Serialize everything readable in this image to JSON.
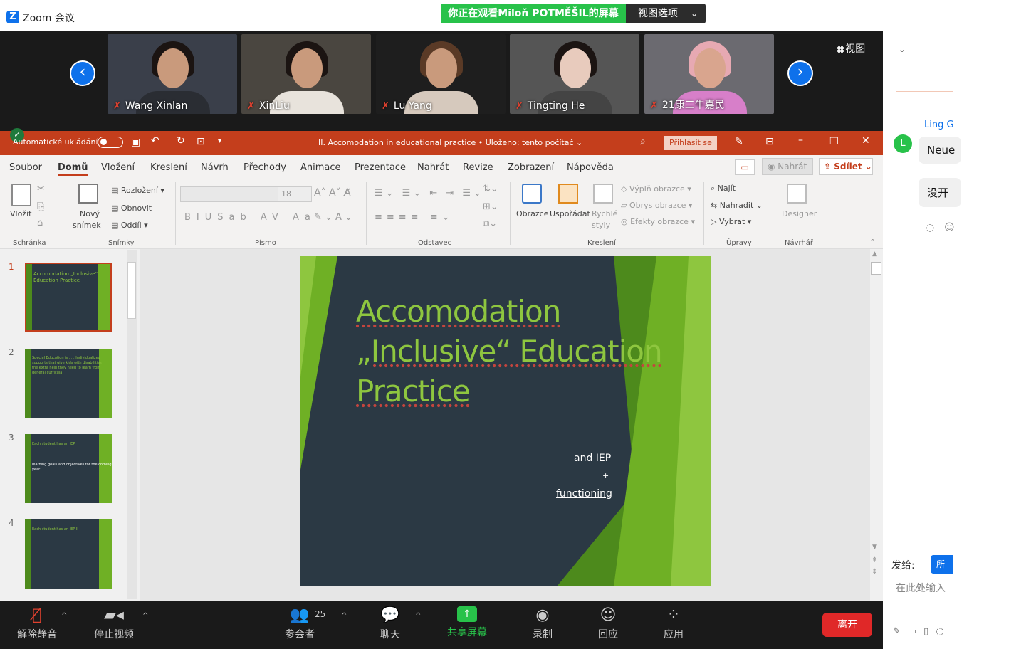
{
  "zoom": {
    "title": "Zoom 会议",
    "share_banner": "你正在观看Miloň  POTMĚŠIL的屏幕",
    "view_options": "视图选项",
    "view_button": "视图",
    "participants": [
      {
        "name": "Wang Xinlan"
      },
      {
        "name": "XinLiu"
      },
      {
        "name": "Lu Yang"
      },
      {
        "name": "Tingting He"
      },
      {
        "name": "21康二牛嘉民"
      }
    ],
    "toolbar": {
      "unmute": "解除静音",
      "stop_video": "停止视频",
      "participants": "参会者",
      "participant_count": "25",
      "chat": "聊天",
      "share": "共享屏幕",
      "record": "录制",
      "reactions": "回应",
      "apps": "应用",
      "leave": "离开"
    }
  },
  "ppt": {
    "autosave_label": "Automatické ukládání",
    "doc_title": "II. Accomodation in educational practice • Uloženo: tento počítač ⌄",
    "signin": "Přihlásit se",
    "tabs": [
      "Soubor",
      "Domů",
      "Vložení",
      "Kreslení",
      "Návrh",
      "Přechody",
      "Animace",
      "Prezentace",
      "Nahrát",
      "Revize",
      "Zobrazení",
      "Nápověda"
    ],
    "record_btn": "Nahrát",
    "share_btn": "Sdílet",
    "ribbon": {
      "paste": "Vložit",
      "new_slide_1": "Nový",
      "new_slide_2": "snímek",
      "layout": "Rozložení",
      "reset": "Obnovit",
      "section": "Oddíl",
      "font_size": "18",
      "shapes": "Obrazce",
      "arrange": "Uspořádat",
      "quick_styles_1": "Rychlé",
      "quick_styles_2": "styly",
      "shape_fill": "Výplň obrazce",
      "shape_outline": "Obrys obrazce",
      "shape_effects": "Efekty obrazce",
      "find": "Najít",
      "replace": "Nahradit",
      "select": "Vybrat",
      "designer": "Designer",
      "groups": [
        "Schránka",
        "Snímky",
        "Písmo",
        "Odstavec",
        "Kreslení",
        "Úpravy",
        "Návrhář"
      ]
    },
    "thumbs": [
      {
        "num": "1",
        "title": "Accomodation „Inclusive“ Education Practice",
        "body": ""
      },
      {
        "num": "2",
        "title": "Special Education is . . . Individualized supports that give kids with disabilities the extra help they need to learn from general curricula",
        "body": ""
      },
      {
        "num": "3",
        "title": "Each student has an IEP",
        "body": "learning goals and objectives for the coming year"
      },
      {
        "num": "4",
        "title": "Each student has an IEP II",
        "body": ""
      }
    ],
    "slide": {
      "title_lines": [
        "Accomodation",
        "„Inclusive“ Education",
        "Practice"
      ],
      "sub1": "and IEP",
      "plus": "+",
      "sub2": "functioning"
    }
  },
  "chat": {
    "sender": "Ling G",
    "avatar_letter": "L",
    "messages": [
      "Neue",
      "没开"
    ],
    "send_to_label": "发给:",
    "send_to_value": "所有",
    "input_placeholder": "在此处输入"
  }
}
